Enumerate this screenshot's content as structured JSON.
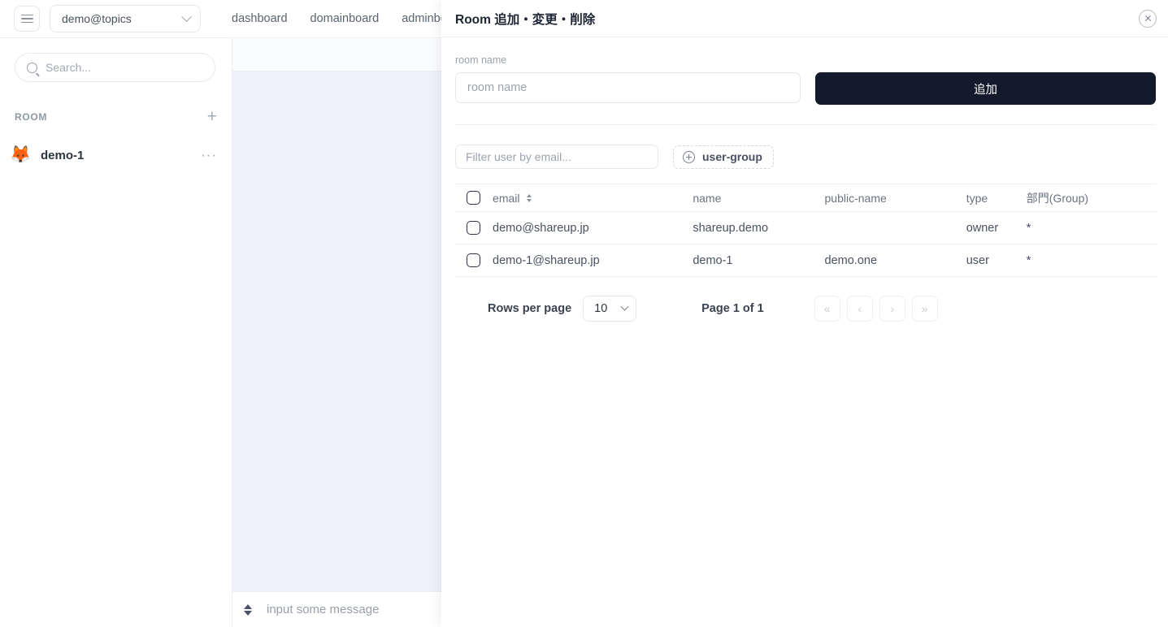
{
  "topbar": {
    "menu_icon": "hamburger-icon",
    "account": {
      "value": "demo@topics",
      "caret_icon": "chevron-down-icon"
    },
    "tabs": [
      {
        "label": "dashboard"
      },
      {
        "label": "domainboard"
      },
      {
        "label": "adminboard"
      }
    ]
  },
  "sidebar": {
    "search": {
      "placeholder": "Search...",
      "icon": "search-icon"
    },
    "section": {
      "title": "ROOM",
      "add_icon": "plus-icon"
    },
    "rooms": [
      {
        "avatar": "🦊",
        "name": "demo-1",
        "menu": "···"
      }
    ]
  },
  "chat": {
    "input_placeholder": "input some message",
    "expand_icon": "up-down-chevron-icon"
  },
  "modal": {
    "title": "Room 追加・変更・削除",
    "close_icon": "close-circle-icon",
    "room_name_label": "room name",
    "room_name_placeholder": "room name",
    "room_name_value": "",
    "add_button": "追加",
    "filter_placeholder": "Filter user by email...",
    "filter_value": "",
    "user_group_button": "user-group",
    "user_group_icon": "circle-plus-icon",
    "table": {
      "columns": [
        {
          "key": "check",
          "label": ""
        },
        {
          "key": "email",
          "label": "email",
          "sortable": true
        },
        {
          "key": "name",
          "label": "name"
        },
        {
          "key": "public_name",
          "label": "public-name"
        },
        {
          "key": "type",
          "label": "type"
        },
        {
          "key": "group",
          "label": "部門(Group)"
        }
      ],
      "rows": [
        {
          "email": "demo@shareup.jp",
          "name": "shareup.demo",
          "public_name": "",
          "type": "owner",
          "group": "*"
        },
        {
          "email": "demo-1@shareup.jp",
          "name": "demo-1",
          "public_name": "demo.one",
          "type": "user",
          "group": "*"
        }
      ]
    },
    "pagination": {
      "rows_per_page_label": "Rows per page",
      "rows_per_page_value": "10",
      "page_info": "Page 1 of 1",
      "first_label": "«",
      "prev_label": "‹",
      "next_label": "›",
      "last_label": "»"
    }
  },
  "colors": {
    "accent_dark": "#131a2c",
    "chat_bg": "#eef1f6",
    "text_primary": "#2d3340",
    "text_muted": "#9aa0ab"
  }
}
